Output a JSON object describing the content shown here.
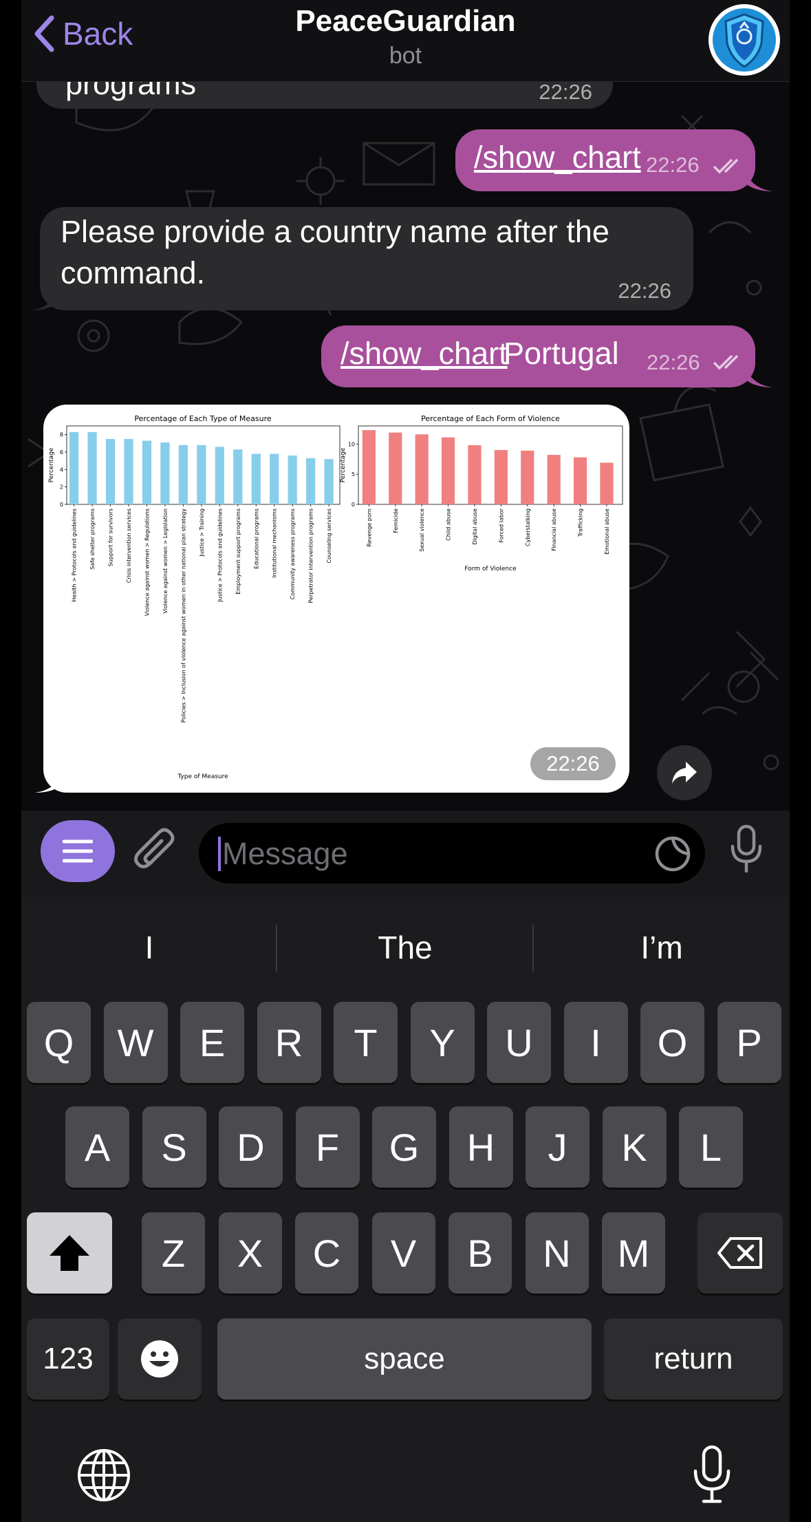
{
  "header": {
    "back_label": "Back",
    "title": "PeaceGuardian",
    "subtitle": "bot"
  },
  "messages": [
    {
      "id": "m0",
      "direction": "in",
      "text": "programs",
      "time": "22:26"
    },
    {
      "id": "m1",
      "direction": "out",
      "command": "/show_chart",
      "text": "",
      "time": "22:26"
    },
    {
      "id": "m2",
      "direction": "in",
      "text_line1": "Please provide a country name after the",
      "text_line2": "command.",
      "time": "22:26"
    },
    {
      "id": "m3",
      "direction": "out",
      "command": "/show_chart",
      "text": "Portugal",
      "time": "22:26"
    },
    {
      "id": "m4",
      "direction": "in",
      "type": "image",
      "time": "22:26"
    }
  ],
  "chart_data": [
    {
      "type": "bar",
      "title": "Percentage of Each Type of Measure",
      "xlabel": "Type of Measure",
      "ylabel": "Percentage",
      "ylim": [
        0,
        9
      ],
      "yticks": [
        "0",
        "2",
        "4",
        "6",
        "8"
      ],
      "color": "#87ceeb",
      "categories": [
        "Health > Protocols and guidelines",
        "Safe shelter programs",
        "Support for survivors",
        "Crisis intervention services",
        "Violence against women > Regulations",
        "Violence against women > Legislation",
        "Policies > Inclusion of violence against women in other national plan strategy",
        "Justice > Training",
        "Justice > Protocols and guidelines",
        "Employment support programs",
        "Educational programs",
        "Institutional mechanisms",
        "Community awareness programs",
        "Perpetrator intervention programs",
        "Counseling services"
      ],
      "values": [
        8.3,
        8.3,
        7.5,
        7.5,
        7.3,
        7.1,
        6.8,
        6.8,
        6.6,
        6.3,
        5.8,
        5.8,
        5.6,
        5.3,
        5.2
      ]
    },
    {
      "type": "bar",
      "title": "Percentage of Each Form of Violence",
      "xlabel": "Form of Violence",
      "ylabel": "Percentage",
      "ylim": [
        0,
        13
      ],
      "yticks": [
        "0",
        "5",
        "10"
      ],
      "color": "#f08080",
      "categories": [
        "Revenge porn",
        "Femicide",
        "Sexual violence",
        "Child abuse",
        "Digital abuse",
        "Forced labor",
        "Cyberstalking",
        "Financial abuse",
        "Trafficking",
        "Emotional abuse"
      ],
      "values": [
        12.3,
        11.9,
        11.6,
        11.1,
        9.8,
        9.0,
        8.9,
        8.2,
        7.8,
        6.9
      ]
    }
  ],
  "input": {
    "placeholder": "Message"
  },
  "keyboard": {
    "suggestions": [
      "I",
      "The",
      "I’m"
    ],
    "row1": [
      "Q",
      "W",
      "E",
      "R",
      "T",
      "Y",
      "U",
      "I",
      "O",
      "P"
    ],
    "row2": [
      "A",
      "S",
      "D",
      "F",
      "G",
      "H",
      "J",
      "K",
      "L"
    ],
    "row3": [
      "Z",
      "X",
      "C",
      "V",
      "B",
      "N",
      "M"
    ],
    "numbers_label": "123",
    "space_label": "space",
    "return_label": "return"
  },
  "colors": {
    "accent": "#9d86e8",
    "outgoing_bubble": "#a8509c",
    "incoming_bubble": "#2b2b2e"
  }
}
